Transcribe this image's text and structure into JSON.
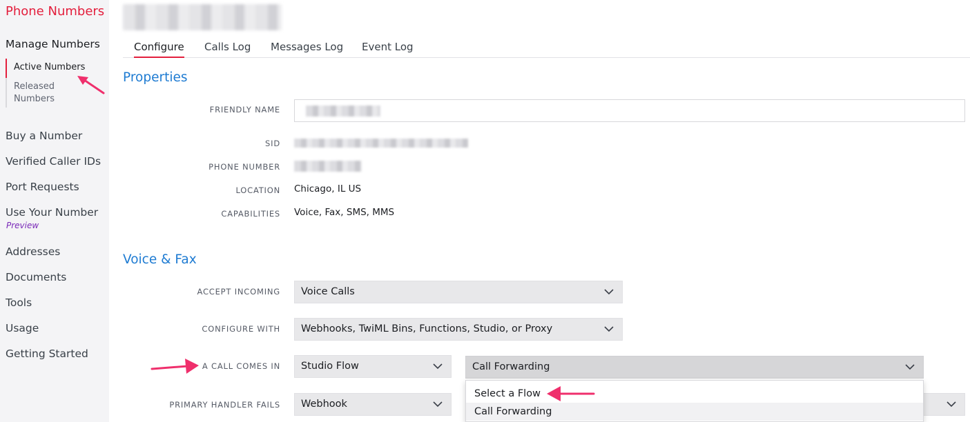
{
  "sidebar": {
    "title": "Phone Numbers",
    "section": "Manage Numbers",
    "sub_items": [
      {
        "label": "Active Numbers"
      },
      {
        "label": "Released Numbers"
      }
    ],
    "items": [
      {
        "label": "Buy a Number"
      },
      {
        "label": "Verified Caller IDs"
      },
      {
        "label": "Port Requests"
      },
      {
        "label": "Use Your Number"
      },
      {
        "label": "Addresses"
      },
      {
        "label": "Documents"
      },
      {
        "label": "Tools"
      },
      {
        "label": "Usage"
      },
      {
        "label": "Getting Started"
      }
    ],
    "preview_badge": "Preview"
  },
  "tabs": [
    {
      "label": "Configure"
    },
    {
      "label": "Calls Log"
    },
    {
      "label": "Messages Log"
    },
    {
      "label": "Event Log"
    }
  ],
  "properties": {
    "heading": "Properties",
    "friendly_name_label": "FRIENDLY NAME",
    "sid_label": "SID",
    "phone_number_label": "PHONE NUMBER",
    "location_label": "LOCATION",
    "location_value": "Chicago, IL US",
    "capabilities_label": "CAPABILITIES",
    "capabilities_value": "Voice, Fax, SMS, MMS"
  },
  "voice_fax": {
    "heading": "Voice & Fax",
    "accept_incoming_label": "ACCEPT INCOMING",
    "accept_incoming_value": "Voice Calls",
    "configure_with_label": "CONFIGURE WITH",
    "configure_with_value": "Webhooks, TwiML Bins, Functions, Studio, or Proxy",
    "call_comes_in_label": "A CALL COMES IN",
    "call_comes_in_value": "Studio Flow",
    "flow_select_value": "Call Forwarding",
    "primary_handler_label": "PRIMARY HANDLER FAILS",
    "primary_handler_value": "Webhook",
    "flow_options": [
      {
        "label": "Select a Flow"
      },
      {
        "label": "Call Forwarding"
      }
    ]
  },
  "colors": {
    "accent_red": "#e31e3c",
    "link_blue": "#1e7bd2",
    "arrow_pink": "#ef2f6c"
  }
}
